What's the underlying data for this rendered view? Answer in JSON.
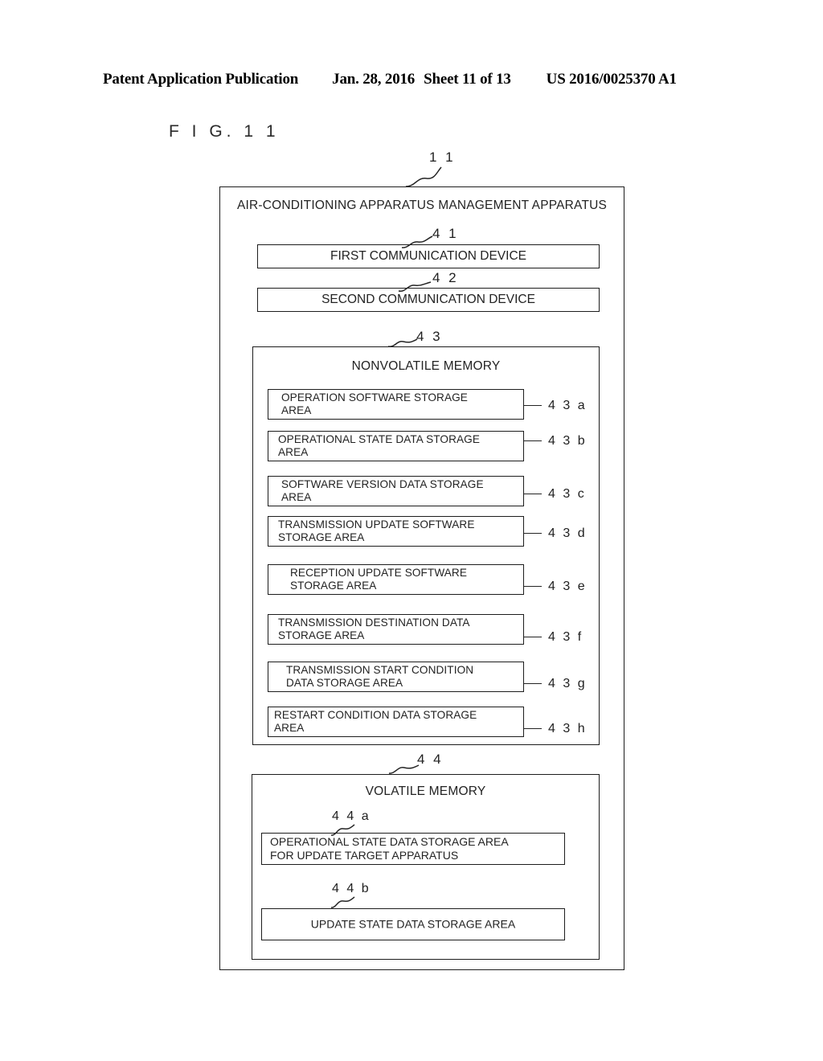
{
  "header": {
    "publication": "Patent Application Publication",
    "date": "Jan. 28, 2016",
    "sheet": "Sheet 11 of 13",
    "doc_number": "US 2016/0025370 A1"
  },
  "figure": {
    "label": "F I G.  1 1"
  },
  "diagram": {
    "outer": {
      "ref": "1 1",
      "title": "AIR-CONDITIONING APPARATUS MANAGEMENT APPARATUS"
    },
    "first_communication_device": {
      "ref": "4 1",
      "label": "FIRST COMMUNICATION DEVICE"
    },
    "second_communication_device": {
      "ref": "4 2",
      "label": "SECOND COMMUNICATION DEVICE"
    },
    "nonvolatile_memory": {
      "ref": "4 3",
      "title": "NONVOLATILE MEMORY",
      "areas": [
        {
          "ref": "4 3 a",
          "line1": "OPERATION SOFTWARE STORAGE",
          "line2": "AREA"
        },
        {
          "ref": "4 3 b",
          "line1": "OPERATIONAL STATE DATA STORAGE",
          "line2": "AREA"
        },
        {
          "ref": "4 3 c",
          "line1": "SOFTWARE VERSION DATA STORAGE",
          "line2": "AREA"
        },
        {
          "ref": "4 3 d",
          "line1": "TRANSMISSION UPDATE SOFTWARE",
          "line2": "STORAGE AREA"
        },
        {
          "ref": "4 3 e",
          "line1": "RECEPTION UPDATE SOFTWARE",
          "line2": "STORAGE AREA"
        },
        {
          "ref": "4 3 f",
          "line1": "TRANSMISSION DESTINATION DATA",
          "line2": "STORAGE AREA"
        },
        {
          "ref": "4 3 g",
          "line1": "TRANSMISSION START CONDITION",
          "line2": "DATA STORAGE AREA"
        },
        {
          "ref": "4 3 h",
          "line1": "RESTART CONDITION DATA STORAGE",
          "line2": "AREA"
        }
      ]
    },
    "volatile_memory": {
      "ref": "4 4",
      "title": "VOLATILE MEMORY",
      "areas": [
        {
          "ref": "4 4 a",
          "line1": "OPERATIONAL STATE DATA STORAGE AREA",
          "line2": "FOR UPDATE TARGET APPARATUS"
        },
        {
          "ref": "4 4 b",
          "line1": "UPDATE STATE DATA STORAGE AREA",
          "line2": ""
        }
      ]
    }
  }
}
